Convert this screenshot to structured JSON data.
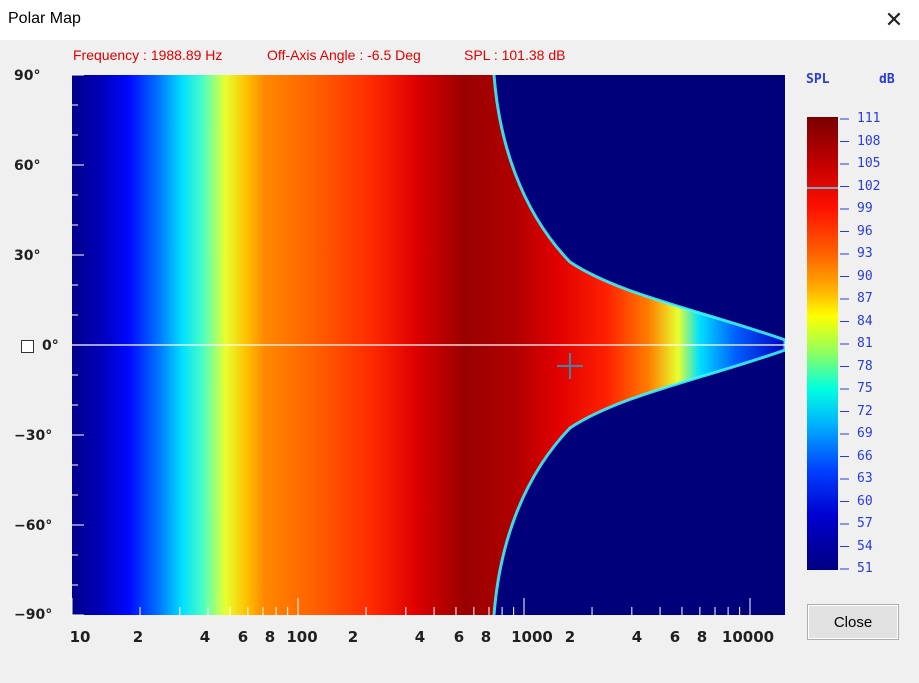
{
  "window": {
    "title": "Polar Map",
    "close_glyph": "✕"
  },
  "readout": {
    "frequency": "Frequency : 1988.89 Hz",
    "angle": "Off-Axis Angle : -6.5 Deg",
    "spl": "SPL : 101.38 dB"
  },
  "y_axis": {
    "labels": [
      "90°",
      "60°",
      "30°",
      "0°",
      "−30°",
      "−60°",
      "−90°"
    ]
  },
  "x_axis": {
    "labels": [
      "10",
      "2",
      "4",
      "6",
      "8",
      "100",
      "2",
      "4",
      "6",
      "8",
      "1000",
      "2",
      "4",
      "6",
      "8",
      "10000"
    ]
  },
  "colorbar": {
    "label_left": "SPL",
    "label_right": "dB",
    "ticks": [
      "111",
      "108",
      "105",
      "102",
      "99",
      "96",
      "93",
      "90",
      "87",
      "84",
      "81",
      "78",
      "75",
      "72",
      "69",
      "66",
      "63",
      "60",
      "57",
      "54",
      "51"
    ],
    "marker_value": 101.38
  },
  "cursor": {
    "frequency_hz": 1988.89,
    "angle_deg": -6.5
  },
  "buttons": {
    "close_label": "Close"
  }
}
